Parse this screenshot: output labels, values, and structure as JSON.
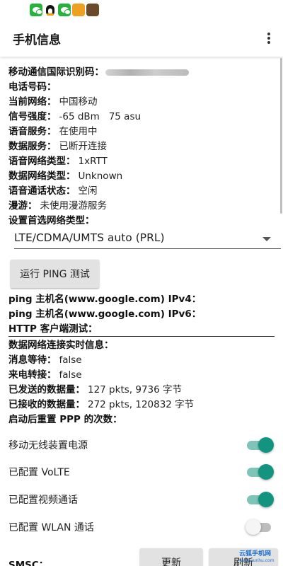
{
  "statusbar": {
    "icons": [
      "wechat-icon",
      "qq-icon",
      "wechat-icon",
      "game-icon",
      "photo-icon"
    ]
  },
  "appbar": {
    "title": "手机信息",
    "menu_icon": "more-vert-icon"
  },
  "info": {
    "imei_label": "移动通信国际识别码：",
    "phone_label": "电话号码：",
    "network_label": "当前网络：",
    "network_value": "中国移动",
    "signal_label": "信号强度：",
    "signal_value": "-65 dBm   75 asu",
    "voice_service_label": "语音服务：",
    "voice_service_value": "在使用中",
    "data_service_label": "数据服务：",
    "data_service_value": "已断开连接",
    "voice_network_type_label": "语音网络类型：",
    "voice_network_type_value": "1xRTT",
    "data_network_type_label": "数据网络类型：",
    "data_network_type_value": "Unknown",
    "call_state_label": "语音通话状态：",
    "call_state_value": "空闲",
    "roaming_label": "漫游：",
    "roaming_value": "未使用漫游服务",
    "preferred_network_label": "设置首选网络类型："
  },
  "preferred_network": {
    "selected": "LTE/CDMA/UMTS auto (PRL)"
  },
  "ping": {
    "button_label": "运行 PING 测试",
    "ipv4_label": "ping 主机名(www.google.com) IPv4：",
    "ipv6_label": "ping 主机名(www.google.com) IPv6：",
    "http_label": "HTTP 客户端测试："
  },
  "data_conn": {
    "realtime_label": "数据网络连接实时信息：",
    "msg_waiting_label": "消息等待：",
    "msg_waiting_value": "false",
    "call_forward_label": "来电转接：",
    "call_forward_value": "false",
    "sent_label": "已发送的数据量：",
    "sent_value": "127 pkts, 9736 字节",
    "received_label": "已接收的数据量：",
    "received_value": "272 pkts, 120832 字节",
    "ppp_reset_label": "启动后重置 PPP 的次数："
  },
  "switches": [
    {
      "label": "移动无线装置电源",
      "on": true
    },
    {
      "label": "已配置 VoLTE",
      "on": true
    },
    {
      "label": "已配置视频通话",
      "on": true
    },
    {
      "label": "已配置 WLAN 通话",
      "on": false
    }
  ],
  "smsc": {
    "label": "SMSC：",
    "update_button": "更新",
    "refresh_button": "刷新"
  },
  "watermark": {
    "name": "云狐手机网",
    "url": "www.yunhu.com"
  },
  "colors": {
    "switch_on": "#139480",
    "switch_on_track": "#7fc4b8",
    "switch_off": "#f5f5f5",
    "button_bg": "#e2e2e2"
  }
}
